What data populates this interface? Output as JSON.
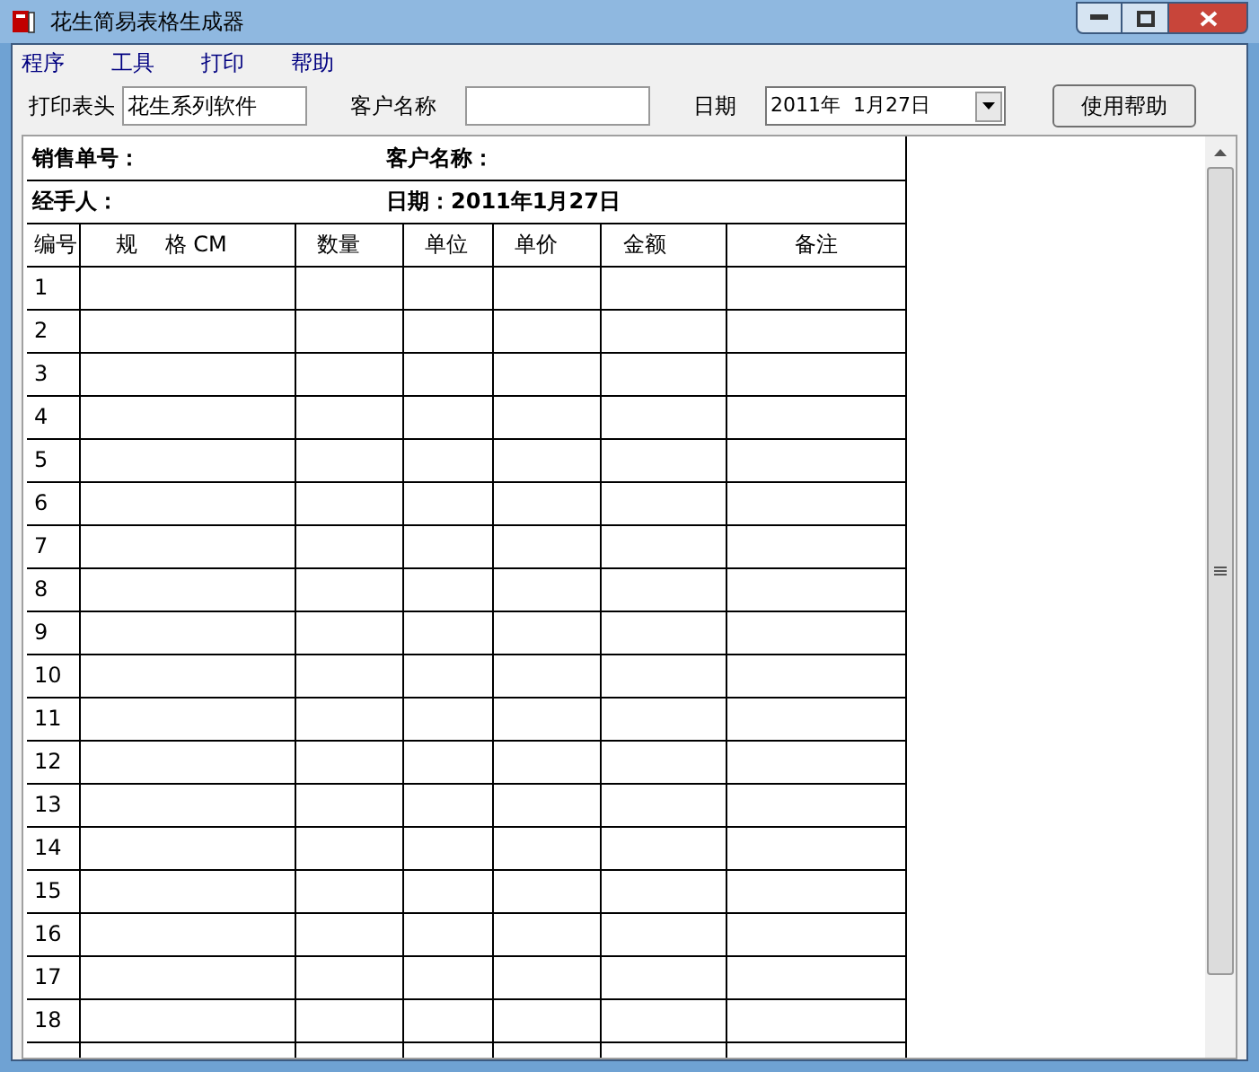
{
  "window": {
    "title": "花生简易表格生成器"
  },
  "menu": [
    "程序",
    "工具",
    "打印",
    "帮助"
  ],
  "toolbar": {
    "header_label": "打印表头",
    "header_value": "花生系列软件",
    "customer_label": "客户名称",
    "date_label": "日期",
    "date_value": "2011年  1月27日",
    "help_button": "使用帮助"
  },
  "sheet": {
    "info": [
      [
        "销售单号：",
        "客户名称："
      ],
      [
        "经手人：",
        "日期：2011年1月27日"
      ]
    ],
    "columns": [
      "编号",
      "规    格 CM",
      "数量",
      "单位",
      "单价",
      "金额",
      "备注"
    ],
    "rows": [
      "1",
      "2",
      "3",
      "4",
      "5",
      "6",
      "7",
      "8",
      "9",
      "10",
      "11",
      "12",
      "13",
      "14",
      "15",
      "16",
      "17",
      "18"
    ]
  }
}
